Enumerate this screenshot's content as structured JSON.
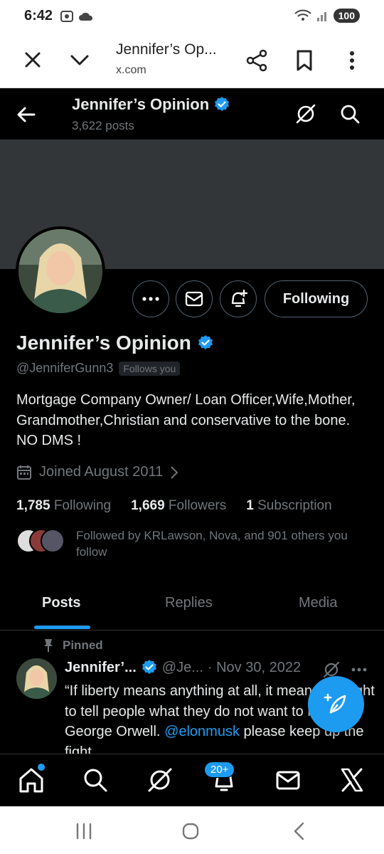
{
  "status_bar": {
    "time": "6:42",
    "battery": "100"
  },
  "browser": {
    "title": "Jennifer’s Op...",
    "url": "x.com"
  },
  "header": {
    "name": "Jennifer’s Opinion",
    "posts": "3,622 posts"
  },
  "profile": {
    "name": "Jennifer’s Opinion",
    "handle": "@JenniferGunn3",
    "follows_you": "Follows you",
    "bio": "Mortgage Company Owner/ Loan Officer,Wife,Mother, Grandmother,Christian and conservative to the bone. NO DMS !",
    "joined": "Joined August 2011",
    "follow_button": "Following",
    "stats": {
      "following_count": "1,785",
      "following_label": "Following",
      "followers_count": "1,669",
      "followers_label": "Followers",
      "subscription_count": "1",
      "subscription_label": "Subscription"
    },
    "followed_by": "Followed by KRLawson, Nova, and 901 others you follow"
  },
  "tabs": [
    {
      "label": "Posts",
      "active": true
    },
    {
      "label": "Replies",
      "active": false
    },
    {
      "label": "Media",
      "active": false
    }
  ],
  "pinned_tweet": {
    "pinned_label": "Pinned",
    "author": "Jennifer’...",
    "handle": "@Je...",
    "date": "· Nov 30, 2022",
    "text_part1": "“If liberty means anything at all, it means the right to tell people what they do not want to hear .” George Orwell. ",
    "mention": "@elonmusk",
    "text_part2": " please keep up the fight"
  },
  "bottom_nav": {
    "notification_badge": "20+"
  },
  "colors": {
    "accent": "#1d9bf0",
    "background": "#000000",
    "muted": "#71767b",
    "text": "#e7e9ea"
  }
}
